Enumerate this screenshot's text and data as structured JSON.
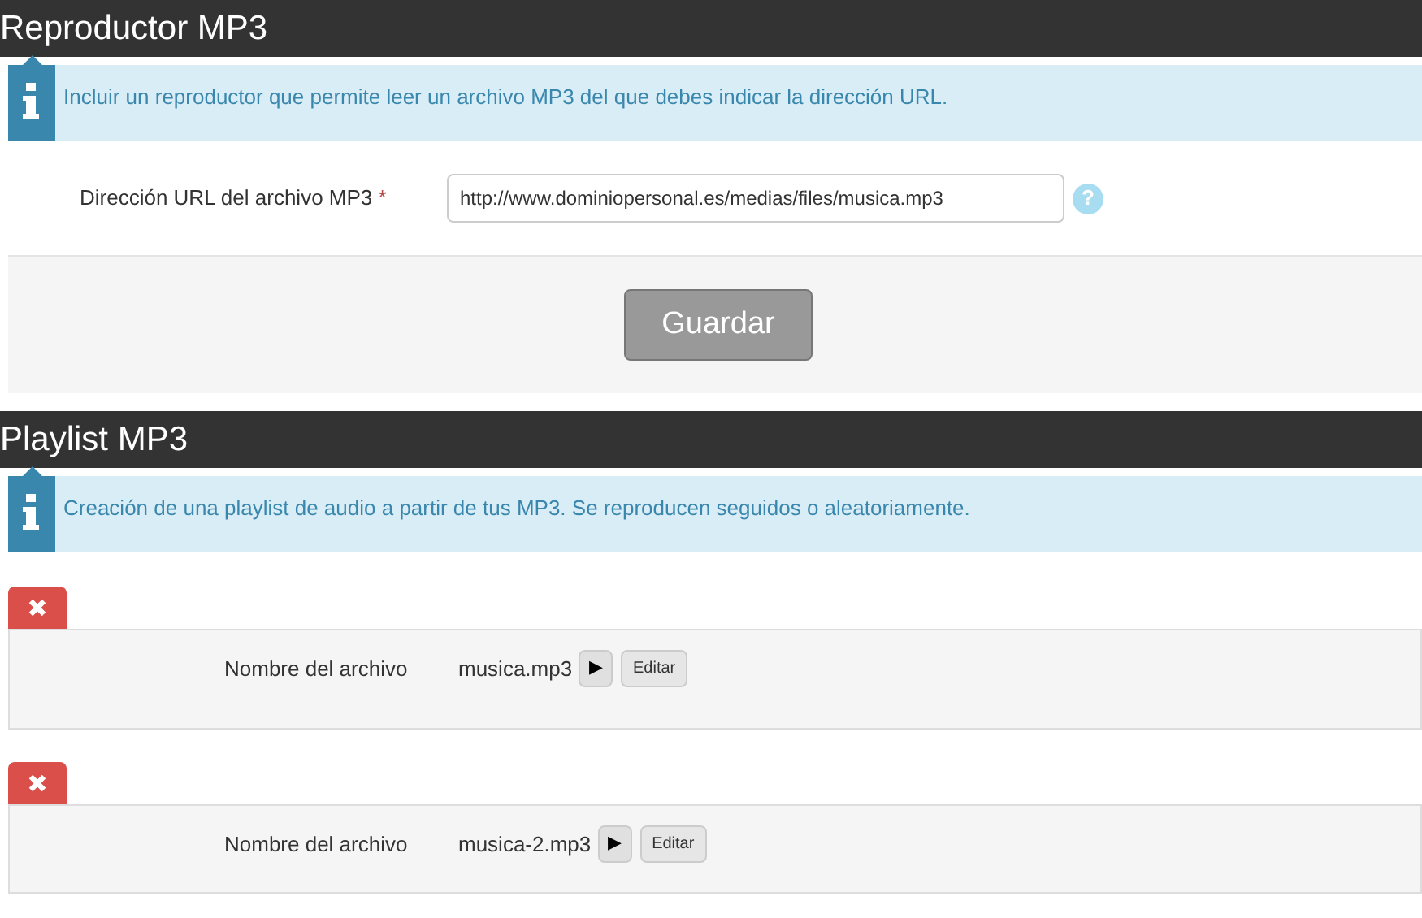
{
  "sections": [
    {
      "title": "Reproductor MP3",
      "info": "Incluir un reproductor que permite leer un archivo MP3 del que debes indicar la dirección URL.",
      "form": {
        "label": "Dirección URL del archivo MP3",
        "required_mark": "*",
        "value": "http://www.dominiopersonal.es/medias/files/musica.mp3",
        "help": "?",
        "submit": "Guardar"
      }
    },
    {
      "title": "Playlist MP3",
      "info": "Creación de una playlist de audio a partir de tus MP3. Se reproducen seguidos o aleatoriamente.",
      "items": [
        {
          "label": "Nombre del archivo",
          "file": "musica.mp3",
          "play": "▶",
          "edit": "Editar"
        },
        {
          "label": "Nombre del archivo",
          "file": "musica-2.mp3",
          "play": "▶",
          "edit": "Editar"
        }
      ]
    }
  ]
}
